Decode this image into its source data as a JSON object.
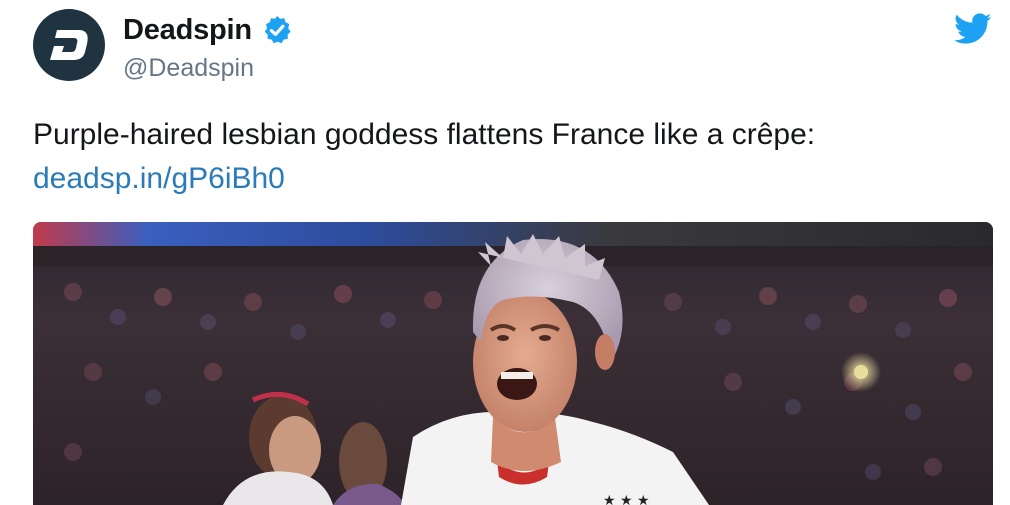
{
  "tweet": {
    "author": {
      "display_name": "Deadspin",
      "handle": "@Deadspin",
      "verified": true,
      "avatar_icon": "deadspin-d-logo"
    },
    "text": "Purple-haired lesbian goddess flattens France like a crêpe:",
    "link": "deadsp.in/gP6iBh0",
    "media": {
      "description_icon": "photo",
      "jersey_stars": "★ ★ ★"
    }
  },
  "colors": {
    "avatar_bg": "#1f3440",
    "verified_blue": "#1da1f2",
    "twitter_blue": "#1da1f2",
    "link_blue": "#2b7bb9",
    "handle_gray": "#657786",
    "text": "#14171a"
  },
  "icons": {
    "verified": "verified-badge-icon",
    "platform": "twitter-bird-icon"
  }
}
